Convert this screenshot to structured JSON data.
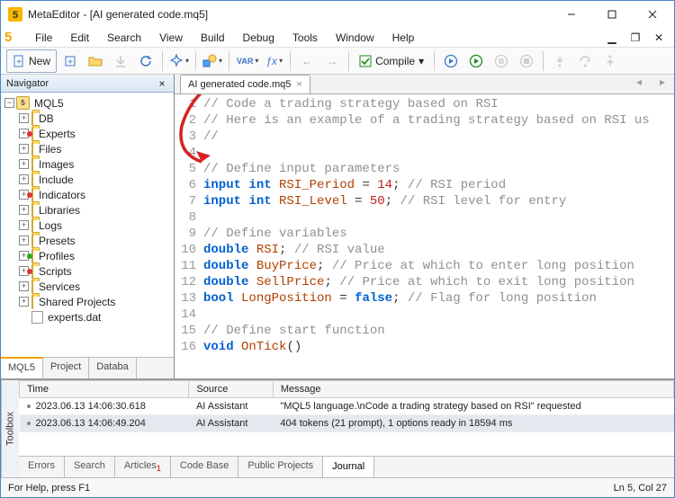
{
  "title": "MetaEditor - [AI generated code.mq5]",
  "menu": [
    "File",
    "Edit",
    "Search",
    "View",
    "Build",
    "Debug",
    "Tools",
    "Window",
    "Help"
  ],
  "toolbar": {
    "new": "New",
    "compile": "Compile",
    "var": "VAR",
    "fx": "ƒx"
  },
  "navigator": {
    "title": "Navigator",
    "root": "MQL5",
    "items": [
      {
        "label": "DB",
        "badge": ""
      },
      {
        "label": "Experts",
        "badge": "red"
      },
      {
        "label": "Files",
        "badge": ""
      },
      {
        "label": "Images",
        "badge": ""
      },
      {
        "label": "Include",
        "badge": ""
      },
      {
        "label": "Indicators",
        "badge": "red"
      },
      {
        "label": "Libraries",
        "badge": ""
      },
      {
        "label": "Logs",
        "badge": ""
      },
      {
        "label": "Presets",
        "badge": ""
      },
      {
        "label": "Profiles",
        "badge": "green"
      },
      {
        "label": "Scripts",
        "badge": "red"
      },
      {
        "label": "Services",
        "badge": ""
      },
      {
        "label": "Shared Projects",
        "badge": ""
      }
    ],
    "file": "experts.dat",
    "tabs": [
      "MQL5",
      "Project",
      "Databa"
    ]
  },
  "editor": {
    "tab": "AI generated code.mq5",
    "lines": [
      {
        "n": 1,
        "seg": [
          {
            "c": "c-cm",
            "t": "// Code a trading strategy based on RSI"
          }
        ]
      },
      {
        "n": 2,
        "seg": [
          {
            "c": "c-cm",
            "t": "// Here is an example of a trading strategy based on RSI us"
          }
        ]
      },
      {
        "n": 3,
        "seg": [
          {
            "c": "c-cm",
            "t": "//"
          }
        ]
      },
      {
        "n": 4,
        "seg": []
      },
      {
        "n": 5,
        "seg": [
          {
            "c": "c-cm",
            "t": "// Define input parameters"
          }
        ]
      },
      {
        "n": 6,
        "seg": [
          {
            "c": "c-kw",
            "t": "input "
          },
          {
            "c": "c-ty",
            "t": "int "
          },
          {
            "c": "c-fn",
            "t": "RSI_Period"
          },
          {
            "c": "c-punc",
            "t": " = "
          },
          {
            "c": "c-num",
            "t": "14"
          },
          {
            "c": "c-punc",
            "t": "; "
          },
          {
            "c": "c-cm",
            "t": "// RSI period"
          }
        ]
      },
      {
        "n": 7,
        "seg": [
          {
            "c": "c-kw",
            "t": "input "
          },
          {
            "c": "c-ty",
            "t": "int "
          },
          {
            "c": "c-fn",
            "t": "RSI_Level"
          },
          {
            "c": "c-punc",
            "t": " = "
          },
          {
            "c": "c-num",
            "t": "50"
          },
          {
            "c": "c-punc",
            "t": "; "
          },
          {
            "c": "c-cm",
            "t": "// RSI level for entry"
          }
        ]
      },
      {
        "n": 8,
        "seg": []
      },
      {
        "n": 9,
        "seg": [
          {
            "c": "c-cm",
            "t": "// Define variables"
          }
        ]
      },
      {
        "n": 10,
        "seg": [
          {
            "c": "c-ty",
            "t": "double "
          },
          {
            "c": "c-fn",
            "t": "RSI"
          },
          {
            "c": "c-punc",
            "t": "; "
          },
          {
            "c": "c-cm",
            "t": "// RSI value"
          }
        ]
      },
      {
        "n": 11,
        "seg": [
          {
            "c": "c-ty",
            "t": "double "
          },
          {
            "c": "c-fn",
            "t": "BuyPrice"
          },
          {
            "c": "c-punc",
            "t": "; "
          },
          {
            "c": "c-cm",
            "t": "// Price at which to enter long position"
          }
        ]
      },
      {
        "n": 12,
        "seg": [
          {
            "c": "c-ty",
            "t": "double "
          },
          {
            "c": "c-fn",
            "t": "SellPrice"
          },
          {
            "c": "c-punc",
            "t": "; "
          },
          {
            "c": "c-cm",
            "t": "// Price at which to exit long position"
          }
        ]
      },
      {
        "n": 13,
        "seg": [
          {
            "c": "c-ty",
            "t": "bool "
          },
          {
            "c": "c-fn",
            "t": "LongPosition"
          },
          {
            "c": "c-punc",
            "t": " = "
          },
          {
            "c": "c-bool",
            "t": "false"
          },
          {
            "c": "c-punc",
            "t": "; "
          },
          {
            "c": "c-cm",
            "t": "// Flag for long position"
          }
        ]
      },
      {
        "n": 14,
        "seg": []
      },
      {
        "n": 15,
        "seg": [
          {
            "c": "c-cm",
            "t": "// Define start function"
          }
        ]
      },
      {
        "n": 16,
        "seg": [
          {
            "c": "c-ty",
            "t": "void "
          },
          {
            "c": "c-fn",
            "t": "OnTick"
          },
          {
            "c": "c-punc",
            "t": "()"
          }
        ]
      }
    ]
  },
  "toolbox": {
    "label": "Toolbox",
    "headers": [
      "Time",
      "Source",
      "Message"
    ],
    "rows": [
      {
        "time": "2023.06.13 14:06:30.618",
        "source": "AI Assistant",
        "message": "\"MQL5 language.\\nCode a trading strategy based on RSI\" requested",
        "sel": false
      },
      {
        "time": "2023.06.13 14:06:49.204",
        "source": "AI Assistant",
        "message": "404 tokens (21 prompt), 1 options ready in 18594 ms",
        "sel": true
      }
    ],
    "tabs": [
      {
        "label": "Errors"
      },
      {
        "label": "Search"
      },
      {
        "label": "Articles",
        "sub": "1"
      },
      {
        "label": "Code Base"
      },
      {
        "label": "Public Projects"
      },
      {
        "label": "Journal",
        "active": true
      }
    ]
  },
  "status": {
    "help": "For Help, press F1",
    "pos": "Ln 5, Col 27"
  }
}
